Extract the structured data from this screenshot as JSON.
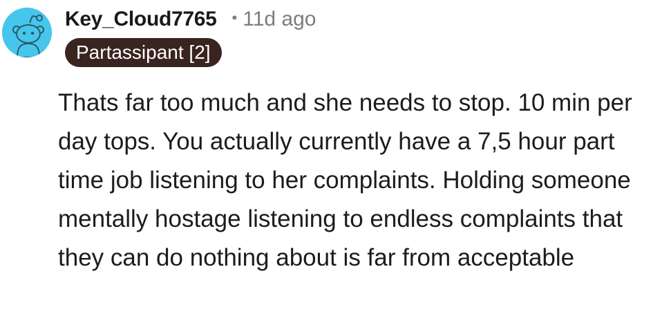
{
  "comment": {
    "author": "Key_Cloud7765",
    "separator": "•",
    "timestamp": "11d ago",
    "flair": "Partassipant [2]",
    "avatar_icon": "snoo-avatar-icon",
    "avatar_color": "#46c6ec",
    "flair_color": "#3a2420",
    "body": "Thats far too much and she needs to stop. 10 min per day tops. You actually currently have a 7,5 hour part time job listening to her complaints. Holding someone mentally hostage listening to endless complaints that they can do nothing about is far from acceptable"
  }
}
